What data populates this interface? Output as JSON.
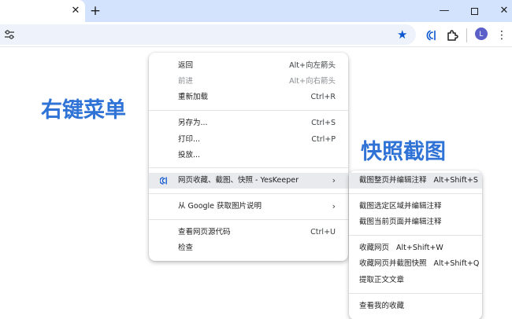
{
  "browser": {
    "tab_close_glyph": "✕",
    "new_tab_glyph": "+",
    "window_minimize_glyph": "—",
    "window_close_glyph": "✕",
    "bookmark_star_glyph": "★",
    "avatar_letter": "L",
    "menu_glyph": "⋮",
    "icons": [
      "site-settings-icon",
      "bookmark-star-icon",
      "yeskeeper-extension-icon",
      "extensions-puzzle-icon",
      "profile-avatar",
      "more-menu-icon"
    ],
    "accent_color": "#0b57d0"
  },
  "page": {
    "heading_right_menu": "右键菜单",
    "heading_snapshot": "快照截图",
    "heading_color": "#2f73d6"
  },
  "context_menu": {
    "items": [
      {
        "label": "返回",
        "shortcut": "Alt+向左箭头"
      },
      {
        "label": "前进",
        "shortcut": "Alt+向右箭头"
      },
      {
        "label": "重新加载",
        "shortcut": "Ctrl+R"
      },
      {
        "label": "另存为...",
        "shortcut": "Ctrl+S"
      },
      {
        "label": "打印...",
        "shortcut": "Ctrl+P"
      },
      {
        "label": "投放..."
      },
      {
        "label": "网页收藏、截图、快照 - YesKeeper",
        "arrow": "›",
        "icon": "yeskeeper-icon"
      },
      {
        "label": "从 Google 获取图片说明",
        "arrow": "›"
      },
      {
        "label": "查看网页源代码",
        "shortcut": "Ctrl+U"
      },
      {
        "label": "检查"
      }
    ]
  },
  "submenu": {
    "items": [
      {
        "label": "截图整页并编辑注释",
        "shortcut": "Alt+Shift+S"
      },
      {
        "label": "截图选定区域并编辑注释"
      },
      {
        "label": "截图当前页面并编辑注释"
      },
      {
        "label": "收藏网页",
        "shortcut": "Alt+Shift+W"
      },
      {
        "label": "收藏网页并截图快照",
        "shortcut": "Alt+Shift+Q"
      },
      {
        "label": "提取正文文章"
      },
      {
        "label": "查看我的收藏"
      }
    ]
  }
}
